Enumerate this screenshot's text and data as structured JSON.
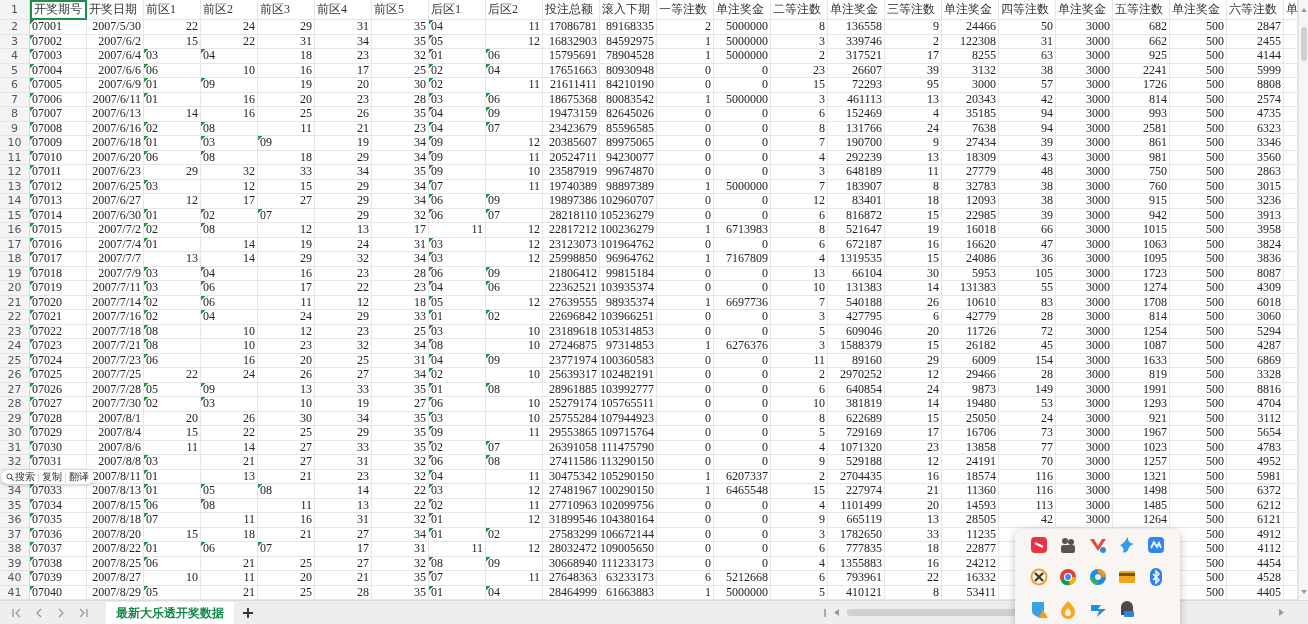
{
  "sheet": {
    "header_row": {
      "number": "1",
      "cells": [
        {
          "value": "开奖期号",
          "selected": true
        },
        {
          "value": "开奖日期",
          "selected": false
        },
        {
          "value": "前区1",
          "selected": false
        },
        {
          "value": "前区2",
          "selected": false
        },
        {
          "value": "前区3",
          "selected": false
        },
        {
          "value": "前区4",
          "selected": false
        },
        {
          "value": "前区5",
          "selected": false
        },
        {
          "value": "后区1",
          "selected": false
        },
        {
          "value": "后区2",
          "selected": false
        },
        {
          "value": "投注总额",
          "selected": false
        },
        {
          "value": "滚入下期",
          "selected": false
        },
        {
          "value": "一等注数",
          "selected": false
        },
        {
          "value": "单注奖金",
          "selected": false
        },
        {
          "value": "二等注数",
          "selected": false
        },
        {
          "value": "单注奖金",
          "selected": false
        },
        {
          "value": "三等注数",
          "selected": false
        },
        {
          "value": "单注奖金",
          "selected": false
        },
        {
          "value": "四等注数",
          "selected": false
        },
        {
          "value": "单注奖金",
          "selected": false
        },
        {
          "value": "五等注数",
          "selected": false
        },
        {
          "value": "单注奖金",
          "selected": false
        },
        {
          "value": "六等注数",
          "selected": false
        },
        {
          "value": "单",
          "selected": false
        }
      ]
    },
    "rows": [
      {
        "number": "2",
        "cells": [
          {
            "kind": "text",
            "value": "07001"
          },
          "2007/5/30",
          "22",
          "24",
          "29",
          "31",
          "35",
          {
            "kind": "text",
            "value": "04"
          },
          "11",
          "17086781",
          "89168335",
          "2",
          "5000000",
          "8",
          "136558",
          "9",
          "24466",
          "50",
          "3000",
          "682",
          "500",
          "2847"
        ]
      },
      {
        "number": "3",
        "cells": [
          {
            "kind": "text",
            "value": "07002"
          },
          "2007/6/2",
          "15",
          "22",
          "31",
          "34",
          "35",
          {
            "kind": "text",
            "value": "05"
          },
          "12",
          "16832903",
          "84592975",
          "1",
          "5000000",
          "3",
          "339746",
          "2",
          "122308",
          "31",
          "3000",
          "662",
          "500",
          "2455"
        ]
      },
      {
        "number": "4",
        "cells": [
          {
            "kind": "text",
            "value": "07003"
          },
          "2007/6/4",
          {
            "kind": "text",
            "value": "03"
          },
          {
            "kind": "text",
            "value": "04"
          },
          "18",
          "23",
          "32",
          {
            "kind": "text",
            "value": "01"
          },
          {
            "kind": "text",
            "value": "06"
          },
          "15795691",
          "78904528",
          "1",
          "5000000",
          "2",
          "317521",
          "17",
          "8255",
          "63",
          "3000",
          "925",
          "500",
          "4144"
        ]
      },
      {
        "number": "5",
        "cells": [
          {
            "kind": "text",
            "value": "07004"
          },
          "2007/6/6",
          {
            "kind": "text",
            "value": "06"
          },
          "10",
          "16",
          "17",
          "25",
          {
            "kind": "text",
            "value": "02"
          },
          {
            "kind": "text",
            "value": "04"
          },
          "17651663",
          "80930948",
          "0",
          "0",
          "23",
          "26607",
          "39",
          "3132",
          "38",
          "3000",
          "2241",
          "500",
          "5999"
        ]
      },
      {
        "number": "6",
        "cells": [
          {
            "kind": "text",
            "value": "07005"
          },
          "2007/6/9",
          {
            "kind": "text",
            "value": "01"
          },
          {
            "kind": "text",
            "value": "09"
          },
          "19",
          "20",
          "30",
          {
            "kind": "text",
            "value": "02"
          },
          "11",
          "21611411",
          "84210190",
          "0",
          "0",
          "15",
          "72293",
          "95",
          "3000",
          "57",
          "3000",
          "1726",
          "500",
          "8808"
        ]
      },
      {
        "number": "7",
        "cells": [
          {
            "kind": "text",
            "value": "07006"
          },
          "2007/6/11",
          {
            "kind": "text",
            "value": "01"
          },
          "16",
          "20",
          "23",
          "28",
          {
            "kind": "text",
            "value": "03"
          },
          {
            "kind": "text",
            "value": "06"
          },
          "18675368",
          "80083542",
          "1",
          "5000000",
          "3",
          "461113",
          "13",
          "20343",
          "42",
          "3000",
          "814",
          "500",
          "2574"
        ]
      },
      {
        "number": "8",
        "cells": [
          {
            "kind": "text",
            "value": "07007"
          },
          "2007/6/13",
          "14",
          "16",
          "25",
          "26",
          "35",
          {
            "kind": "text",
            "value": "04"
          },
          {
            "kind": "text",
            "value": "09"
          },
          "19473159",
          "82645026",
          "0",
          "0",
          "6",
          "152469",
          "4",
          "35185",
          "94",
          "3000",
          "993",
          "500",
          "4735"
        ]
      },
      {
        "number": "9",
        "cells": [
          {
            "kind": "text",
            "value": "07008"
          },
          "2007/6/16",
          {
            "kind": "text",
            "value": "02"
          },
          {
            "kind": "text",
            "value": "08"
          },
          "11",
          "21",
          "23",
          {
            "kind": "text",
            "value": "04"
          },
          {
            "kind": "text",
            "value": "07"
          },
          "23423679",
          "85596585",
          "0",
          "0",
          "8",
          "131766",
          "24",
          "7638",
          "94",
          "3000",
          "2581",
          "500",
          "6323"
        ]
      },
      {
        "number": "10",
        "cells": [
          {
            "kind": "text",
            "value": "07009"
          },
          "2007/6/18",
          {
            "kind": "text",
            "value": "01"
          },
          {
            "kind": "text",
            "value": "03"
          },
          {
            "kind": "text",
            "value": "09"
          },
          "19",
          "34",
          {
            "kind": "text",
            "value": "09"
          },
          "12",
          "20385607",
          "89975065",
          "0",
          "0",
          "7",
          "190700",
          "9",
          "27434",
          "39",
          "3000",
          "861",
          "500",
          "3346"
        ]
      },
      {
        "number": "11",
        "cells": [
          {
            "kind": "text",
            "value": "07010"
          },
          "2007/6/20",
          {
            "kind": "text",
            "value": "06"
          },
          {
            "kind": "text",
            "value": "08"
          },
          "18",
          "29",
          "34",
          {
            "kind": "text",
            "value": "09"
          },
          "11",
          "20524711",
          "94230077",
          "0",
          "0",
          "4",
          "292239",
          "13",
          "18309",
          "43",
          "3000",
          "981",
          "500",
          "3560"
        ]
      },
      {
        "number": "12",
        "cells": [
          {
            "kind": "text",
            "value": "07011"
          },
          "2007/6/23",
          "29",
          "32",
          "33",
          "34",
          "35",
          {
            "kind": "text",
            "value": "09"
          },
          "10",
          "23587919",
          "99674870",
          "0",
          "0",
          "3",
          "648189",
          "11",
          "27779",
          "48",
          "3000",
          "750",
          "500",
          "2863"
        ]
      },
      {
        "number": "13",
        "cells": [
          {
            "kind": "text",
            "value": "07012"
          },
          "2007/6/25",
          {
            "kind": "text",
            "value": "03"
          },
          "12",
          "15",
          "29",
          "34",
          {
            "kind": "text",
            "value": "07"
          },
          "11",
          "19740389",
          "98897389",
          "1",
          "5000000",
          "7",
          "183907",
          "8",
          "32783",
          "38",
          "3000",
          "760",
          "500",
          "3015"
        ]
      },
      {
        "number": "14",
        "cells": [
          {
            "kind": "text",
            "value": "07013"
          },
          "2007/6/27",
          "12",
          "17",
          "27",
          "29",
          "34",
          {
            "kind": "text",
            "value": "06"
          },
          {
            "kind": "text",
            "value": "09"
          },
          "19897386",
          "102960707",
          "0",
          "0",
          "12",
          "83401",
          "18",
          "12093",
          "38",
          "3000",
          "915",
          "500",
          "3236"
        ]
      },
      {
        "number": "15",
        "cells": [
          {
            "kind": "text",
            "value": "07014"
          },
          "2007/6/30",
          {
            "kind": "text",
            "value": "01"
          },
          {
            "kind": "text",
            "value": "02"
          },
          {
            "kind": "text",
            "value": "07"
          },
          "29",
          "32",
          {
            "kind": "text",
            "value": "06"
          },
          {
            "kind": "text",
            "value": "07"
          },
          "28218110",
          "105236279",
          "0",
          "0",
          "6",
          "816872",
          "15",
          "22985",
          "39",
          "3000",
          "942",
          "500",
          "3913"
        ]
      },
      {
        "number": "16",
        "cells": [
          {
            "kind": "text",
            "value": "07015"
          },
          "2007/7/2",
          {
            "kind": "text",
            "value": "02"
          },
          {
            "kind": "text",
            "value": "08"
          },
          "12",
          "13",
          "17",
          "11",
          "12",
          "22817212",
          "100236279",
          "1",
          "6713983",
          "8",
          "521647",
          "19",
          "16018",
          "66",
          "3000",
          "1015",
          "500",
          "3958"
        ]
      },
      {
        "number": "17",
        "cells": [
          {
            "kind": "text",
            "value": "07016"
          },
          "2007/7/4",
          {
            "kind": "text",
            "value": "01"
          },
          "14",
          "19",
          "24",
          "31",
          {
            "kind": "text",
            "value": "03"
          },
          "12",
          "23123073",
          "101964762",
          "0",
          "0",
          "6",
          "672187",
          "16",
          "16620",
          "47",
          "3000",
          "1063",
          "500",
          "3824"
        ]
      },
      {
        "number": "18",
        "cells": [
          {
            "kind": "text",
            "value": "07017"
          },
          "2007/7/7",
          "13",
          "14",
          "29",
          "32",
          "34",
          {
            "kind": "text",
            "value": "03"
          },
          "12",
          "25998850",
          "96964762",
          "1",
          "7167809",
          "4",
          "1319535",
          "15",
          "24086",
          "36",
          "3000",
          "1095",
          "500",
          "3836"
        ]
      },
      {
        "number": "19",
        "cells": [
          {
            "kind": "text",
            "value": "07018"
          },
          "2007/7/9",
          {
            "kind": "text",
            "value": "03"
          },
          {
            "kind": "text",
            "value": "04"
          },
          "16",
          "23",
          "28",
          {
            "kind": "text",
            "value": "06"
          },
          {
            "kind": "text",
            "value": "09"
          },
          "21806412",
          "99815184",
          "0",
          "0",
          "13",
          "66104",
          "30",
          "5953",
          "105",
          "3000",
          "1723",
          "500",
          "8087"
        ]
      },
      {
        "number": "20",
        "cells": [
          {
            "kind": "text",
            "value": "07019"
          },
          "2007/7/11",
          {
            "kind": "text",
            "value": "03"
          },
          {
            "kind": "text",
            "value": "06"
          },
          "17",
          "22",
          "23",
          {
            "kind": "text",
            "value": "04"
          },
          {
            "kind": "text",
            "value": "06"
          },
          "22362521",
          "103935374",
          "0",
          "0",
          "10",
          "131383",
          "14",
          "131383",
          "55",
          "3000",
          "1274",
          "500",
          "4309"
        ]
      },
      {
        "number": "21",
        "cells": [
          {
            "kind": "text",
            "value": "07020"
          },
          "2007/7/14",
          {
            "kind": "text",
            "value": "02"
          },
          {
            "kind": "text",
            "value": "06"
          },
          "11",
          "12",
          "18",
          {
            "kind": "text",
            "value": "05"
          },
          "12",
          "27639555",
          "98935374",
          "1",
          "6697736",
          "7",
          "540188",
          "26",
          "10610",
          "83",
          "3000",
          "1708",
          "500",
          "6018"
        ]
      },
      {
        "number": "22",
        "cells": [
          {
            "kind": "text",
            "value": "07021"
          },
          "2007/7/16",
          {
            "kind": "text",
            "value": "02"
          },
          {
            "kind": "text",
            "value": "04"
          },
          "24",
          "29",
          "33",
          {
            "kind": "text",
            "value": "01"
          },
          {
            "kind": "text",
            "value": "02"
          },
          "22696842",
          "103966251",
          "0",
          "0",
          "3",
          "427795",
          "6",
          "42779",
          "28",
          "3000",
          "814",
          "500",
          "3060"
        ]
      },
      {
        "number": "23",
        "cells": [
          {
            "kind": "text",
            "value": "07022"
          },
          "2007/7/18",
          {
            "kind": "text",
            "value": "08"
          },
          "10",
          "12",
          "23",
          "25",
          {
            "kind": "text",
            "value": "03"
          },
          "10",
          "23189618",
          "105314853",
          "0",
          "0",
          "5",
          "609046",
          "20",
          "11726",
          "72",
          "3000",
          "1254",
          "500",
          "5294"
        ]
      },
      {
        "number": "24",
        "cells": [
          {
            "kind": "text",
            "value": "07023"
          },
          "2007/7/21",
          {
            "kind": "text",
            "value": "08"
          },
          "10",
          "23",
          "32",
          "34",
          {
            "kind": "text",
            "value": "08"
          },
          "10",
          "27246875",
          "97314853",
          "1",
          "6276376",
          "3",
          "1588379",
          "15",
          "26182",
          "45",
          "3000",
          "1087",
          "500",
          "4287"
        ]
      },
      {
        "number": "25",
        "cells": [
          {
            "kind": "text",
            "value": "07024"
          },
          "2007/7/23",
          {
            "kind": "text",
            "value": "06"
          },
          "16",
          "20",
          "25",
          "31",
          {
            "kind": "text",
            "value": "04"
          },
          {
            "kind": "text",
            "value": "09"
          },
          "23771974",
          "100360583",
          "0",
          "0",
          "11",
          "89160",
          "29",
          "6009",
          "154",
          "3000",
          "1633",
          "500",
          "6869"
        ]
      },
      {
        "number": "26",
        "cells": [
          {
            "kind": "text",
            "value": "07025"
          },
          "2007/7/25",
          "22",
          "24",
          "26",
          "27",
          "34",
          {
            "kind": "text",
            "value": "02"
          },
          "10",
          "25639317",
          "102482191",
          "0",
          "0",
          "2",
          "2970252",
          "12",
          "29466",
          "28",
          "3000",
          "819",
          "500",
          "3328"
        ]
      },
      {
        "number": "27",
        "cells": [
          {
            "kind": "text",
            "value": "07026"
          },
          "2007/7/28",
          {
            "kind": "text",
            "value": "05"
          },
          {
            "kind": "text",
            "value": "09"
          },
          "13",
          "33",
          "35",
          {
            "kind": "text",
            "value": "01"
          },
          {
            "kind": "text",
            "value": "08"
          },
          "28961885",
          "103992777",
          "0",
          "0",
          "6",
          "640854",
          "24",
          "9873",
          "149",
          "3000",
          "1991",
          "500",
          "8816"
        ]
      },
      {
        "number": "28",
        "cells": [
          {
            "kind": "text",
            "value": "07027"
          },
          "2007/7/30",
          {
            "kind": "text",
            "value": "02"
          },
          {
            "kind": "text",
            "value": "03"
          },
          "10",
          "19",
          "27",
          {
            "kind": "text",
            "value": "06"
          },
          "10",
          "25279174",
          "105765511",
          "0",
          "0",
          "10",
          "381819",
          "14",
          "19480",
          "53",
          "3000",
          "1293",
          "500",
          "4704"
        ]
      },
      {
        "number": "29",
        "cells": [
          {
            "kind": "text",
            "value": "07028"
          },
          "2007/8/1",
          "20",
          "26",
          "30",
          "34",
          "35",
          {
            "kind": "text",
            "value": "03"
          },
          "10",
          "25755284",
          "107944923",
          "0",
          "0",
          "8",
          "622689",
          "15",
          "25050",
          "24",
          "3000",
          "921",
          "500",
          "3112"
        ]
      },
      {
        "number": "30",
        "cells": [
          {
            "kind": "text",
            "value": "07029"
          },
          "2007/8/4",
          "15",
          "22",
          "25",
          "29",
          "35",
          {
            "kind": "text",
            "value": "09"
          },
          "11",
          "29553865",
          "109715764",
          "0",
          "0",
          "5",
          "729169",
          "17",
          "16706",
          "73",
          "3000",
          "1967",
          "500",
          "5654"
        ]
      },
      {
        "number": "31",
        "cells": [
          {
            "kind": "text",
            "value": "07030"
          },
          "2007/8/6",
          "11",
          "14",
          "27",
          "33",
          "35",
          {
            "kind": "text",
            "value": "02"
          },
          {
            "kind": "text",
            "value": "07"
          },
          "26391058",
          "111475790",
          "0",
          "0",
          "4",
          "1071320",
          "23",
          "13858",
          "77",
          "3000",
          "1023",
          "500",
          "4783"
        ]
      },
      {
        "number": "32",
        "cells": [
          {
            "kind": "text",
            "value": "07031"
          },
          "2007/8/8",
          {
            "kind": "text",
            "value": "03"
          },
          "21",
          "27",
          "31",
          "32",
          {
            "kind": "text",
            "value": "06"
          },
          {
            "kind": "text",
            "value": "08"
          },
          "27411586",
          "113290150",
          "0",
          "0",
          "9",
          "529188",
          "12",
          "24191",
          "70",
          "3000",
          "1257",
          "500",
          "4952"
        ]
      },
      {
        "cells": [
          null,
          "2007/8/11",
          {
            "kind": "text",
            "value": "01"
          },
          "13",
          "21",
          "23",
          "32",
          {
            "kind": "text",
            "value": "04"
          },
          "11",
          "30475342",
          "105290150",
          "1",
          "6207337",
          "2",
          "2704435",
          "16",
          "18574",
          "116",
          "3000",
          "1321",
          "500",
          "5981"
        ]
      },
      {
        "number": "34",
        "cells": [
          {
            "kind": "text",
            "value": "07033"
          },
          "2007/8/13",
          {
            "kind": "text",
            "value": "01"
          },
          {
            "kind": "text",
            "value": "05"
          },
          {
            "kind": "text",
            "value": "08"
          },
          "14",
          "22",
          {
            "kind": "text",
            "value": "03"
          },
          "12",
          "27481967",
          "100290150",
          "1",
          "6465548",
          "15",
          "227974",
          "21",
          "11360",
          "116",
          "3000",
          "1498",
          "500",
          "6372"
        ]
      },
      {
        "number": "35",
        "cells": [
          {
            "kind": "text",
            "value": "07034"
          },
          "2007/8/15",
          {
            "kind": "text",
            "value": "06"
          },
          {
            "kind": "text",
            "value": "08"
          },
          "11",
          "13",
          "22",
          {
            "kind": "text",
            "value": "02"
          },
          "11",
          "27710963",
          "102099756",
          "0",
          "0",
          "4",
          "1101499",
          "20",
          "14593",
          "113",
          "3000",
          "1485",
          "500",
          "6212"
        ]
      },
      {
        "number": "36",
        "cells": [
          {
            "kind": "text",
            "value": "07035"
          },
          "2007/8/18",
          {
            "kind": "text",
            "value": "07"
          },
          "11",
          "16",
          "31",
          "32",
          {
            "kind": "text",
            "value": "01"
          },
          "12",
          "31899546",
          "104380164",
          "0",
          "0",
          "9",
          "665119",
          "13",
          "28505",
          "42",
          "3000",
          "1264",
          "500",
          "6121"
        ]
      },
      {
        "number": "37",
        "cells": [
          {
            "kind": "text",
            "value": "07036"
          },
          "2007/8/20",
          "15",
          "18",
          "21",
          "27",
          "34",
          {
            "kind": "text",
            "value": "01"
          },
          {
            "kind": "text",
            "value": "02"
          },
          "27583299",
          "106672144",
          "0",
          "0",
          "3",
          "1782650",
          "33",
          "11235",
          null,
          null,
          null,
          "500",
          "4912"
        ]
      },
      {
        "number": "38",
        "cells": [
          {
            "kind": "text",
            "value": "07037"
          },
          "2007/8/22",
          {
            "kind": "text",
            "value": "01"
          },
          {
            "kind": "text",
            "value": "06"
          },
          {
            "kind": "text",
            "value": "07"
          },
          "17",
          "31",
          "11",
          "12",
          "28032472",
          "109005650",
          "0",
          "0",
          "6",
          "777835",
          "18",
          "22877",
          null,
          null,
          null,
          "500",
          "4112"
        ]
      },
      {
        "number": "39",
        "cells": [
          {
            "kind": "text",
            "value": "07038"
          },
          "2007/8/25",
          {
            "kind": "text",
            "value": "06"
          },
          "21",
          "25",
          "27",
          "32",
          {
            "kind": "text",
            "value": "08"
          },
          {
            "kind": "text",
            "value": "09"
          },
          "30668940",
          "111233173",
          "0",
          "0",
          "4",
          "1355883",
          "16",
          "24212",
          null,
          null,
          null,
          "500",
          "4454"
        ]
      },
      {
        "number": "40",
        "cells": [
          {
            "kind": "text",
            "value": "07039"
          },
          "2007/8/27",
          "10",
          "11",
          "20",
          "21",
          "35",
          {
            "kind": "text",
            "value": "07"
          },
          "11",
          "27648363",
          "63233173",
          "6",
          "5212668",
          "6",
          "793961",
          "22",
          "16332",
          null,
          null,
          null,
          "500",
          "4528"
        ]
      },
      {
        "number": "41",
        "cells": [
          {
            "kind": "text",
            "value": "07040"
          },
          "2007/8/29",
          {
            "kind": "text",
            "value": "05"
          },
          "21",
          "25",
          "28",
          "35",
          {
            "kind": "text",
            "value": "01"
          },
          {
            "kind": "text",
            "value": "04"
          },
          "28464999",
          "61663883",
          "1",
          "5000000",
          "5",
          "410121",
          "8",
          "53411",
          null,
          null,
          null,
          "500",
          "4405"
        ]
      }
    ]
  },
  "sheet_tabs": [
    {
      "label": "最新大乐透开奖数据",
      "selected": true
    }
  ],
  "context_menu": {
    "items": [
      {
        "kind": "search",
        "label": "搜索"
      },
      {
        "kind": "plain",
        "label": "复制"
      },
      {
        "kind": "plain",
        "label": "翻译"
      }
    ]
  }
}
